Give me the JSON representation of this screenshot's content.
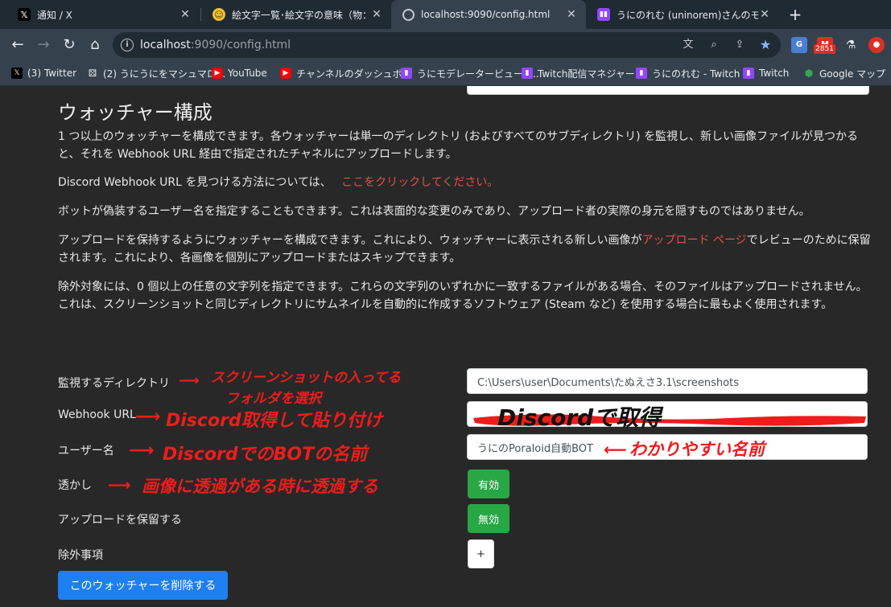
{
  "tabs": [
    {
      "title": "通知 / X",
      "icon": "x-logo-icon"
    },
    {
      "title": "絵文字一覧･絵文字の意味（物：",
      "icon": "emoji-icon"
    },
    {
      "title": "localhost:9090/config.html",
      "icon": "globe-icon"
    },
    {
      "title": "うにのれむ (uninorem)さんのモデレー",
      "icon": "twitch-icon"
    }
  ],
  "address_bar": {
    "host": "localhost",
    "rest": ":9090/config.html"
  },
  "extension_badge": "2851",
  "bookmarks": [
    {
      "label": "(3) Twitter",
      "icon": "x-logo-icon"
    },
    {
      "label": "(2) うにうにをマシュマロ...",
      "icon": "dice-icon"
    },
    {
      "label": "YouTube",
      "icon": "youtube-icon"
    },
    {
      "label": "チャンネルのダッシュボ...",
      "icon": "youtube-icon"
    },
    {
      "label": "うにモデレータービュー -...",
      "icon": "twitch-icon"
    },
    {
      "label": "Twitch配信マネジャー",
      "icon": "twitch-icon"
    },
    {
      "label": "うにのれむ - Twitch",
      "icon": "twitch-icon"
    },
    {
      "label": "Twitch",
      "icon": "twitch-icon"
    },
    {
      "label": "Google マップ",
      "icon": "google-maps-icon"
    }
  ],
  "page": {
    "heading": "ウォッチャー構成",
    "para1": "1 つ以上のウォッチャーを構成できます。各ウォッチャーは単一のディレクトリ (およびすべてのサブディレクトリ) を監視し、新しい画像ファイルが見つかると、それを Webhook URL 経由で指定されたチャネルにアップロードします。",
    "para2_text": "Discord Webhook URL を見つける方法については、",
    "para2_link": "ここをクリックしてください。",
    "para3": "ボットが偽装するユーザー名を指定することもできます。これは表面的な変更のみであり、アップロード者の実際の身元を隠すものではありません。",
    "para4_before": "アップロードを保持するようにウォッチャーを構成できます。これにより、ウォッチャーに表示される新しい画像が",
    "para4_link": "アップロード ページ",
    "para4_after": "でレビューのために保留されます。これにより、各画像を個別にアップロードまたはスキップできます。",
    "para5": "除外対象には、0 個以上の任意の文字列を指定できます。これらの文字列のいずれかに一致するファイルがある場合、そのファイルはアップロードされません。これは、スクリーンショットと同じディレクトリにサムネイルを自動的に作成するソフトウェア (Steam など) を使用する場合に最もよく使用されます。"
  },
  "form": {
    "directory_label": "監視するディレクトリ",
    "directory_value": "C:\\Users\\user\\Documents\\たぬえさ3.1\\screenshots",
    "webhook_label": "Webhook URL",
    "username_label": "ユーザー名",
    "username_value": "うにのPoraloid自動BOT",
    "watermark_label": "透かし",
    "watermark_button": "有効",
    "hold_label": "アップロードを保留する",
    "hold_button": "無効",
    "exclusions_label": "除外事項",
    "add_exclusion_button": "+",
    "delete_button": "このウォッチャーを削除する"
  },
  "annotations": {
    "directory_note_line1": "スクリーンショットの入ってる",
    "directory_note_line2": "フォルダを選択",
    "webhook_note": "Discord取得して貼り付け",
    "webhook_field_note": "Discordで取得",
    "username_note": "DiscordでのBOTの名前",
    "username_field_note": "わかりやすい名前",
    "watermark_note": "画像に透過がある時に透過する"
  },
  "colors": {
    "page_bg": "#282828",
    "link": "#e0514b",
    "success": "#28a745",
    "primary": "#1d7ff0",
    "annotation": "#ee1c1c"
  }
}
